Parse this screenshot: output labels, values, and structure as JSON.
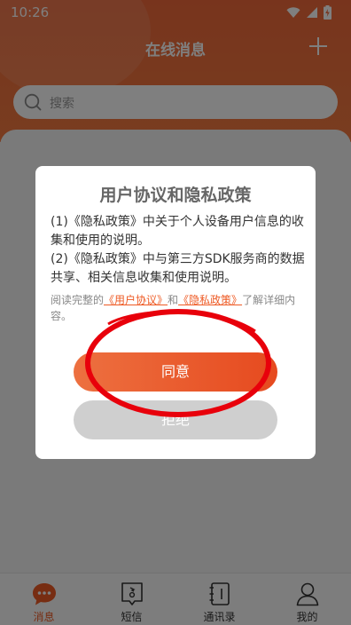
{
  "status_bar": {
    "time": "10:26"
  },
  "header": {
    "title": "在线消息"
  },
  "search": {
    "placeholder": "搜索"
  },
  "dialog": {
    "title": "用户协议和隐私政策",
    "paragraph1": "(1)《隐私政策》中关于个人设备用户信息的收集和使用的说明。",
    "paragraph2": "(2)《隐私政策》中与第三方SDK服务商的数据共享、相关信息收集和使用说明。",
    "note_prefix": "阅读完整的",
    "user_agreement_link": "《用户协议》",
    "note_and": "和",
    "privacy_policy_link": "《隐私政策》",
    "note_suffix": "了解详细内容。",
    "agree_label": "同意",
    "reject_label": "拒绝"
  },
  "tabs": [
    {
      "label": "消息",
      "icon": "message-bubble-icon",
      "active": true
    },
    {
      "label": "短信",
      "icon": "sms-icon",
      "active": false
    },
    {
      "label": "通讯录",
      "icon": "contacts-icon",
      "active": false
    },
    {
      "label": "我的",
      "icon": "person-icon",
      "active": false
    }
  ],
  "colors": {
    "brand": "#ee5a24",
    "header": "#f0693a",
    "annotation": "#e8000b"
  }
}
